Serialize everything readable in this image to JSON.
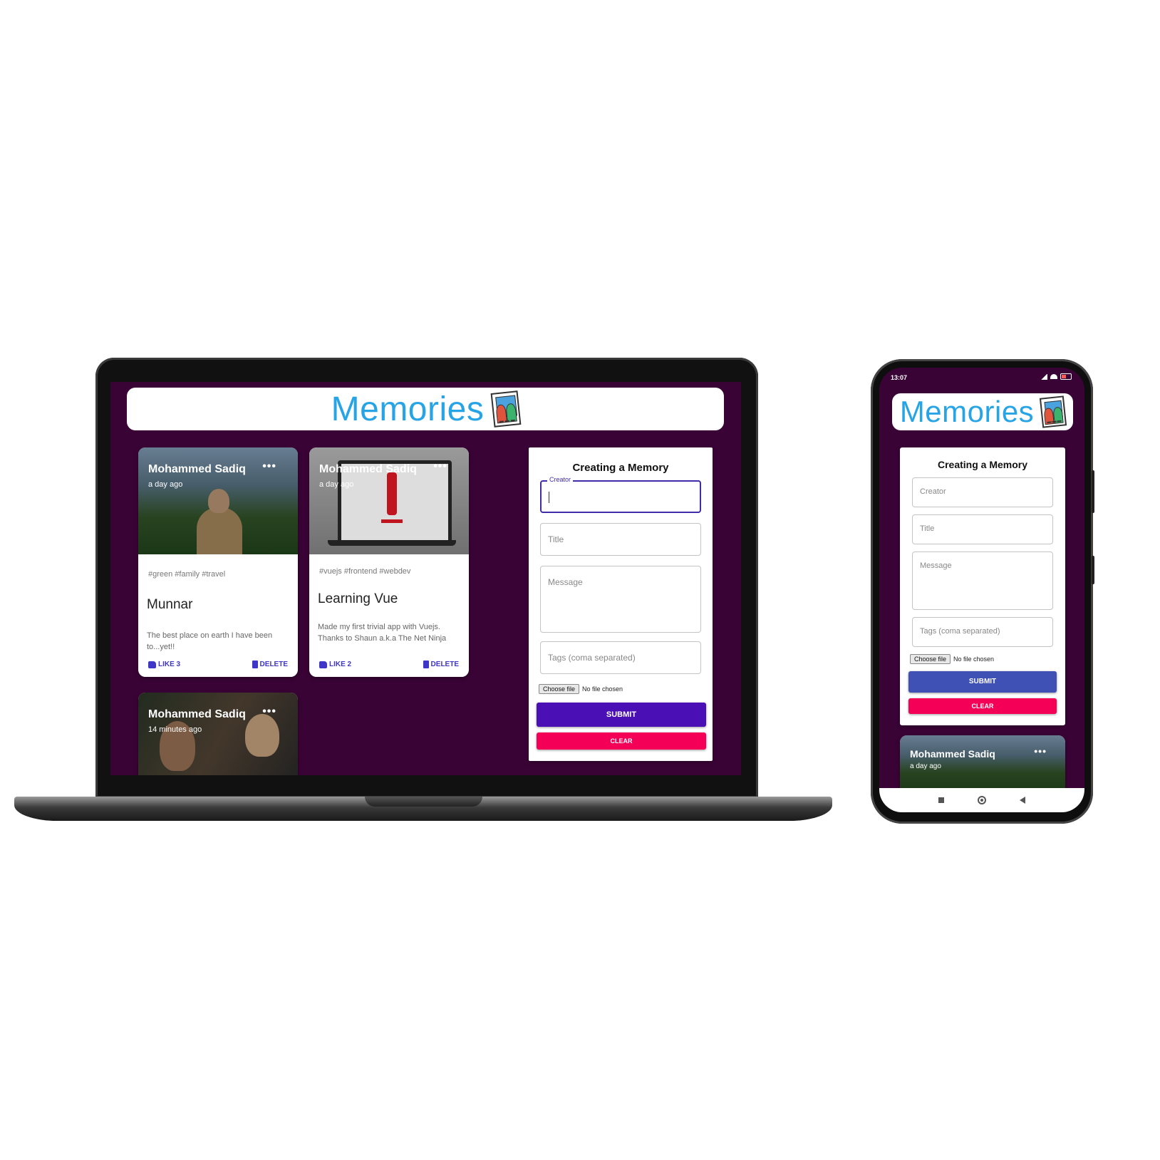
{
  "brand": {
    "name": "Memories",
    "accent": "#27a4e6",
    "logo_icon": "photo-memories-icon"
  },
  "theme": {
    "background": "#3a0336",
    "submit_laptop": "#4a0fb5",
    "submit_phone": "#3f51b5",
    "clear": "#f50057",
    "link": "#3f36c8"
  },
  "posts": [
    {
      "creator": "Mohammed Sadiq",
      "time": "a day ago",
      "tags": "#green #family #travel",
      "title": "Munnar",
      "message": "The best place on earth I have been to...yet!!",
      "like": "LIKE 3",
      "delete": "DELETE"
    },
    {
      "creator": "Mohammed Sadiq",
      "time": "a day ago",
      "tags": "#vuejs #frontend #webdev",
      "title": "Learning Vue",
      "message": "Made my first trivial app with Vuejs. Thanks to Shaun a.k.a The Net Ninja",
      "like": "LIKE 2",
      "delete": "DELETE"
    },
    {
      "creator": "Mohammed Sadiq",
      "time": "14 minutes ago"
    }
  ],
  "form": {
    "title": "Creating a Memory",
    "creator_label": "Creator",
    "title_placeholder": "Title",
    "message_placeholder": "Message",
    "tags_placeholder": "Tags (coma separated)",
    "file_button": "Choose file",
    "file_status": "No file chosen",
    "submit": "SUBMIT",
    "clear": "CLEAR"
  },
  "mobile": {
    "status_time": "13:07",
    "status_battery": "battery-icon",
    "post_preview": {
      "creator": "Mohammed Sadiq",
      "time": "a day ago"
    }
  },
  "more_label": "•••"
}
